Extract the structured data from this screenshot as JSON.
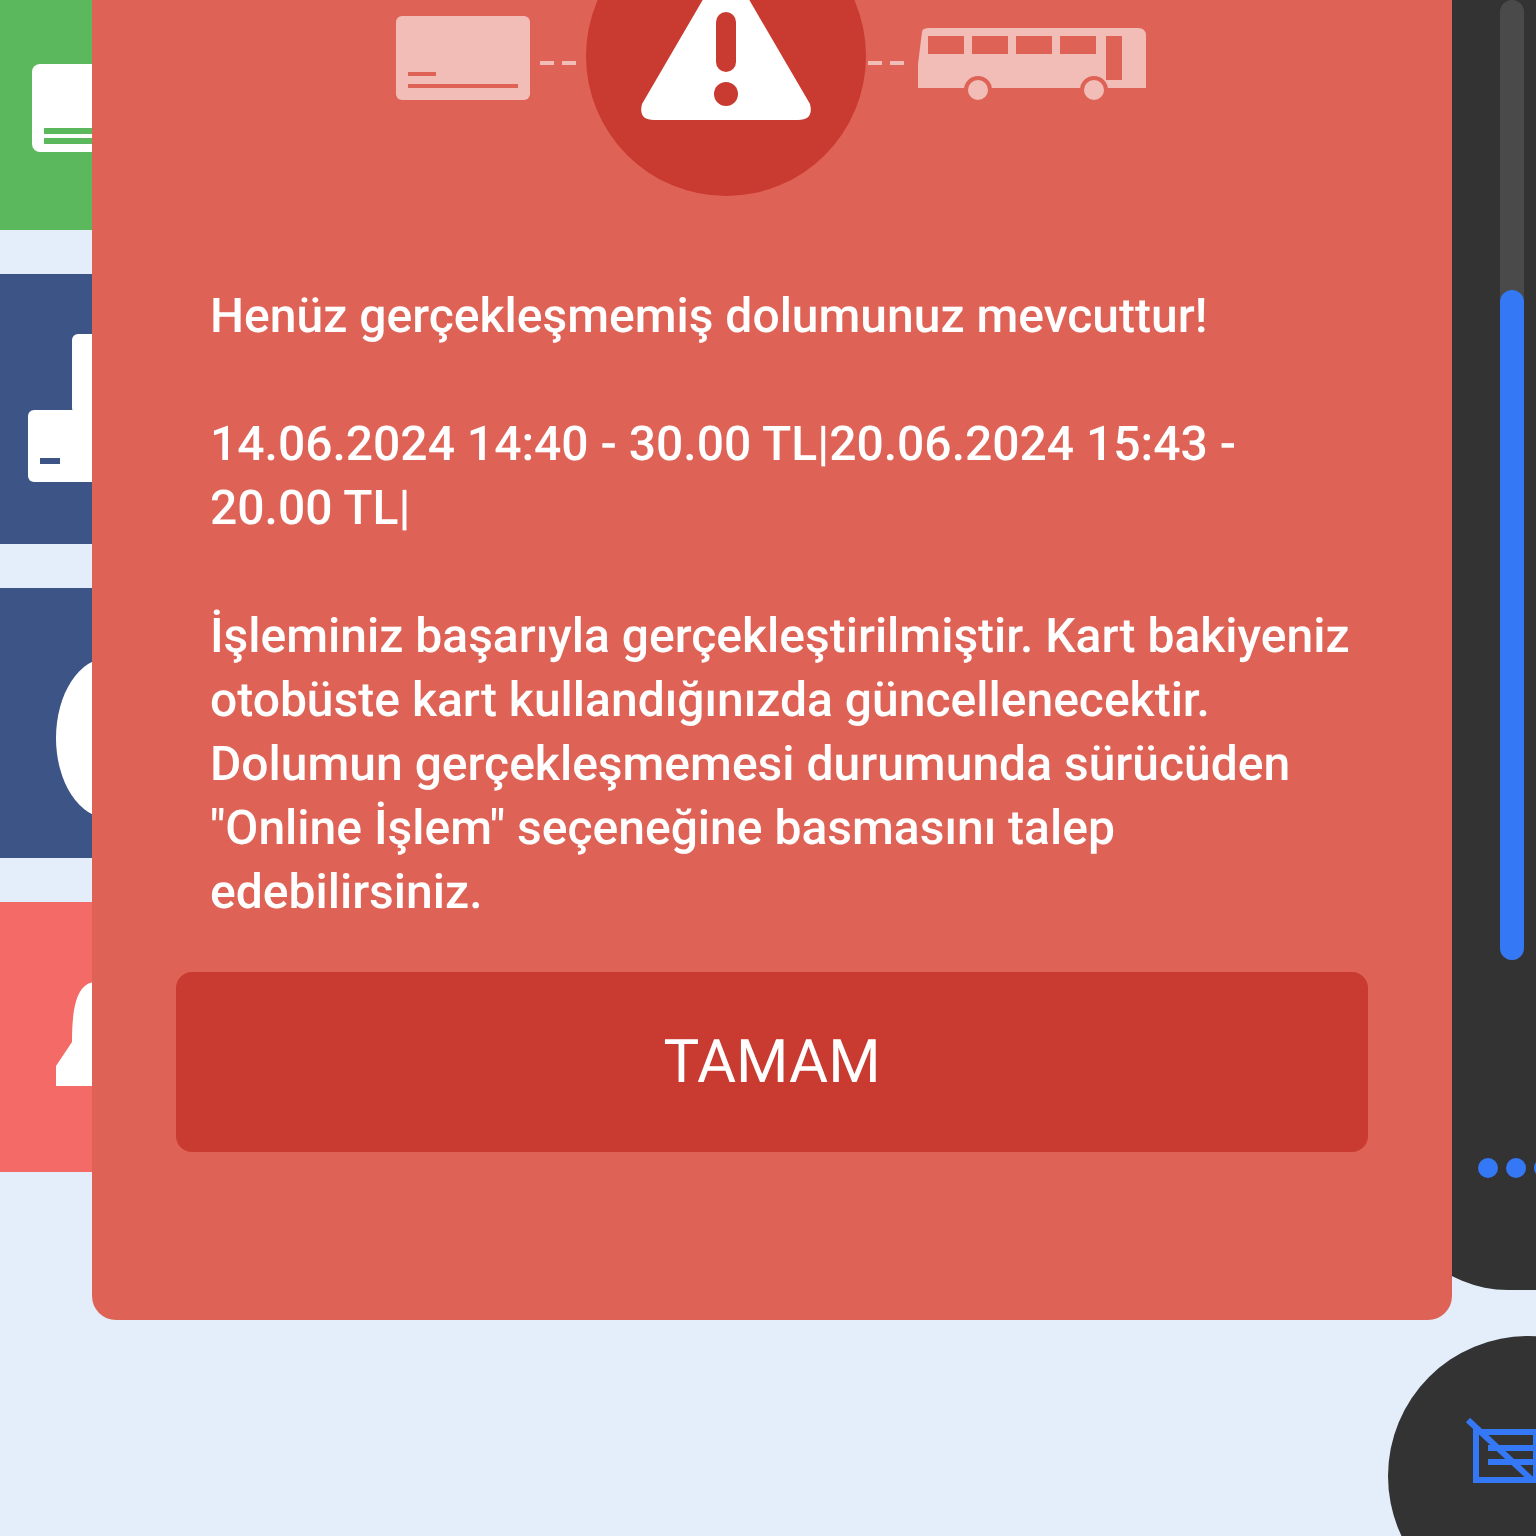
{
  "dialog": {
    "paragraphs": [
      "Henüz gerçekleşmemiş dolumunuz mevcuttur!",
      "14.06.2024 14:40 - 30.00 TL|20.06.2024 15:43 - 20.00 TL|",
      "İşleminiz başarıyla gerçekleştirilmiştir.  Kart bakiyeniz otobüste kart kullandığınızda güncellenecektir. Dolumun gerçekleşmemesi durumunda sürücüden  \"Online İşlem\" seçeneğine basmasını talep edebilirsiniz."
    ],
    "button": "TAMAM"
  },
  "tiles": [
    {
      "color": "#5cb85c"
    },
    {
      "color": "#3d5487"
    },
    {
      "color": "#3d5487"
    },
    {
      "color": "#f46a66"
    }
  ]
}
